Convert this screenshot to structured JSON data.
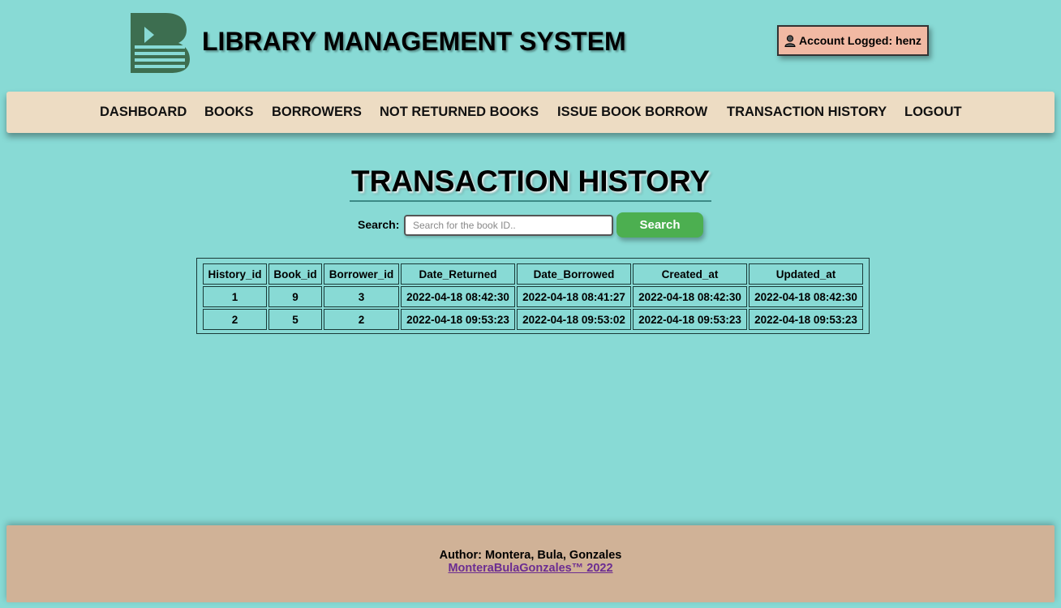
{
  "header": {
    "app_title": "LIBRARY MANAGEMENT SYSTEM",
    "logo_icon": "book-logo-icon",
    "account_label": "Account Logged: henz",
    "account_icon": "user-icon"
  },
  "nav": {
    "items": [
      {
        "label": "DASHBOARD"
      },
      {
        "label": "BOOKS"
      },
      {
        "label": "BORROWERS"
      },
      {
        "label": "NOT RETURNED BOOKS"
      },
      {
        "label": "ISSUE BOOK BORROW"
      },
      {
        "label": "TRANSACTION HISTORY"
      },
      {
        "label": "LOGOUT"
      }
    ]
  },
  "main": {
    "heading": "TRANSACTION HISTORY",
    "search": {
      "label": "Search:",
      "placeholder": "Search for the book ID..",
      "value": "",
      "button_label": "Search"
    },
    "table": {
      "columns": [
        "History_id",
        "Book_id",
        "Borrower_id",
        "Date_Returned",
        "Date_Borrowed",
        "Created_at",
        "Updated_at"
      ],
      "rows": [
        [
          "1",
          "9",
          "3",
          "2022-04-18 08:42:30",
          "2022-04-18 08:41:27",
          "2022-04-18 08:42:30",
          "2022-04-18 08:42:30"
        ],
        [
          "2",
          "5",
          "2",
          "2022-04-18 09:53:23",
          "2022-04-18 09:53:02",
          "2022-04-18 09:53:23",
          "2022-04-18 09:53:23"
        ]
      ]
    }
  },
  "footer": {
    "author": "Author: Montera, Bula, Gonzales",
    "link_text": "MonteraBulaGonzales™ 2022"
  },
  "colors": {
    "background": "#88dad5",
    "navbar": "#eddcc3",
    "footer": "#d0b297",
    "account_badge": "#f1b9a3",
    "search_button": "#4caf50",
    "logo": "#3d6e50",
    "footer_link": "#6b2c91"
  }
}
